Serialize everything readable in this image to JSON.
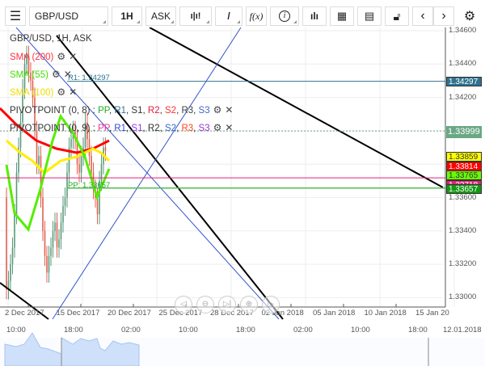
{
  "toolbar": {
    "menu_icon": "hamburger-icon",
    "symbol": "GBP/USD",
    "timeframe": "1H",
    "price_type": "ASK",
    "chart_type_icon": "candlestick-icon",
    "draw_icon": "pencil-icon",
    "indicator_label": "f(x)",
    "info_icon": "info-icon",
    "volume_icon": "bar-chart-icon",
    "calendar_icon": "calendar-icon",
    "news_icon": "newspaper-icon",
    "lock_icon": "unlock-icon",
    "prev_icon": "chevron-left-icon",
    "next_icon": "chevron-right-icon",
    "settings_icon": "gear-icon"
  },
  "legend": {
    "title": "GBP/USD, 1H, ASK",
    "sma200": "SMA (200)",
    "sma55": "SMA (55)",
    "sma100": "SMA (100)",
    "pivot1": {
      "name": "PIVOTPOINT (0, 8)",
      "sep": " : ",
      "pp": "PP",
      "r1": "R1",
      "s1": "S1",
      "r2": "R2",
      "s2": "S2",
      "r3": "R3",
      "s3": "S3"
    },
    "pivot2": {
      "name": "PIVOTPOINT (0, 9)",
      "sep": " : ",
      "pp": "PP",
      "r1": "R1",
      "s1": "S1",
      "r2": "R2",
      "s2": "S2",
      "r3": "R3",
      "s3": "S3"
    }
  },
  "chart_labels": {
    "r1": "R1: 1.34297",
    "pp": "PP: 1.33657"
  },
  "price_axis": {
    "ticks": [
      "1.34600",
      "1.34400",
      "1.34200",
      "1.33600",
      "1.33400",
      "1.33200",
      "1.33000"
    ]
  },
  "price_labels": [
    {
      "value": "1.34297",
      "bg": "#2e7391",
      "fg": "#ffffff"
    },
    {
      "value": "1.33999",
      "bg": "#6aa884",
      "fg": "#ffffff"
    },
    {
      "value": "1.33859",
      "bg": "#ffff00",
      "fg": "#333333"
    },
    {
      "value": "1.33814",
      "bg": "#ff0000",
      "fg": "#ffffff"
    },
    {
      "value": "1.33765",
      "bg": "#66ff00",
      "fg": "#333333"
    },
    {
      "value": "1.33718",
      "bg": "#e0207a",
      "fg": "#ffffff"
    },
    {
      "value": "1.33657",
      "bg": "#119911",
      "fg": "#ffffff"
    }
  ],
  "date_axis": [
    "2 Dec 2017",
    "15 Dec 2017",
    "20 Dec 2017",
    "25 Dec 2017",
    "28 Dec 2017",
    "02 Jan 2018",
    "05 Jan 2018",
    "10 Jan 2018",
    "15 Jan 20"
  ],
  "time_axis": [
    "10:00",
    "18:00",
    "02:00",
    "10:00",
    "18:00",
    "02:00",
    "10:00",
    "18:00"
  ],
  "time_axis_date": "12.01.2018",
  "nav_icons": [
    "arrow-left-icon",
    "zoom-out-icon",
    "skip-end-icon",
    "zoom-in-icon",
    "arrow-right-icon"
  ],
  "colors": {
    "sma200": "#ff0000",
    "sma55": "#55ee00",
    "sma100": "#ffee00",
    "bull": "#5a9a7a",
    "bear": "#e06050"
  }
}
